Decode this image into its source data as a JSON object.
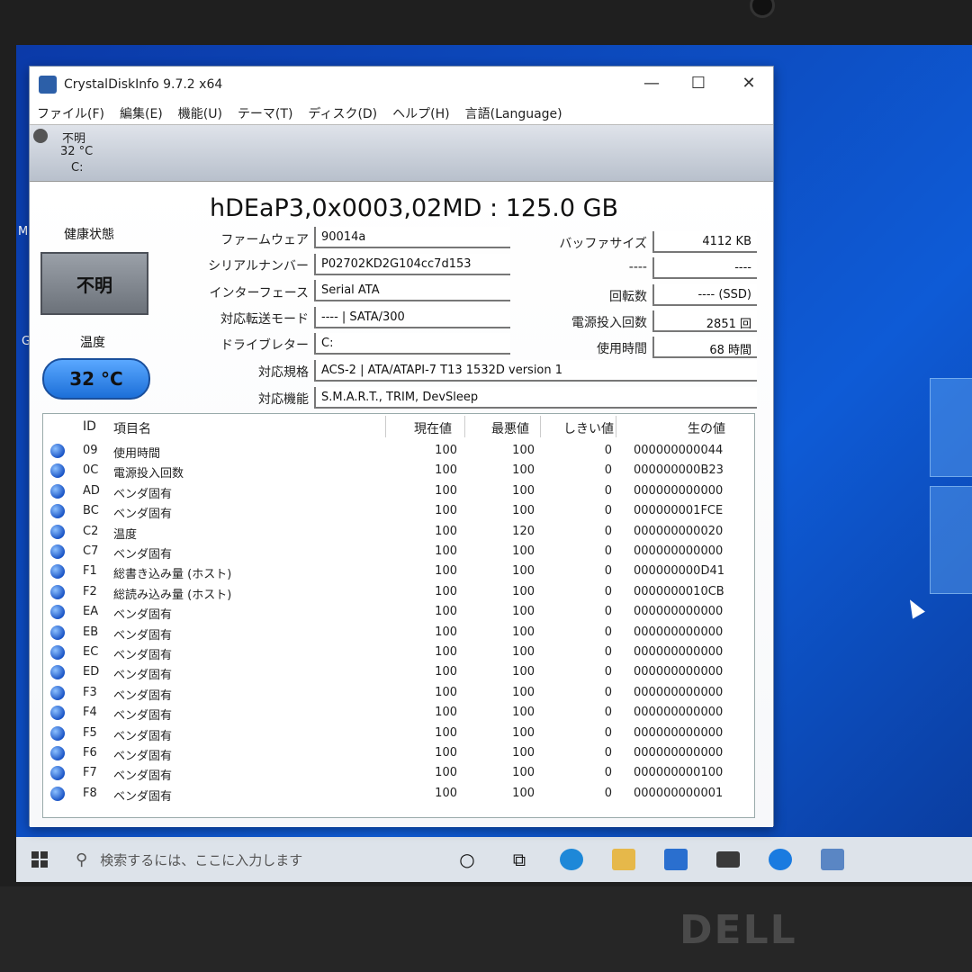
{
  "app": {
    "title": "CrystalDiskInfo 9.7.2 x64",
    "controls": {
      "minimize": "—",
      "maximize": "☐",
      "close": "✕"
    },
    "menu": [
      "ファイル(F)",
      "編集(E)",
      "機能(U)",
      "テーマ(T)",
      "ディスク(D)",
      "ヘルプ(H)",
      "言語(Language)"
    ]
  },
  "disk_tab": {
    "status": "不明",
    "temp": "32 °C",
    "letter": "C:"
  },
  "disk": {
    "model": "hDEaP3,0x0003,02MD : 125.0 GB",
    "health_label": "健康状態",
    "health_value": "不明",
    "temp_label": "温度",
    "temp_value": "32 °C",
    "firmware_label": "ファームウェア",
    "firmware": "90014a",
    "serial_label": "シリアルナンバー",
    "serial": "P02702KD2G104cc7d153",
    "interface_label": "インターフェース",
    "interface": "Serial ATA",
    "transfer_label": "対応転送モード",
    "transfer": "---- | SATA/300",
    "drive_label": "ドライブレター",
    "drive": "C:",
    "standard_label": "対応規格",
    "standard": "ACS-2 | ATA/ATAPI-7 T13 1532D version 1",
    "features_label": "対応機能",
    "features": "S.M.A.R.T., TRIM, DevSleep",
    "buffer_label": "バッファサイズ",
    "buffer": "4112 KB",
    "unknown_label": "----",
    "unknown": "----",
    "rotation_label": "回転数",
    "rotation": "---- (SSD)",
    "power_count_label": "電源投入回数",
    "power_count": "2851 回",
    "power_hours_label": "使用時間",
    "power_hours": "68 時間"
  },
  "smart": {
    "headers": {
      "id": "ID",
      "name": "項目名",
      "current": "現在値",
      "worst": "最悪値",
      "threshold": "しきい値",
      "raw": "生の値"
    },
    "rows": [
      {
        "id": "09",
        "name": "使用時間",
        "current": "100",
        "worst": "100",
        "threshold": "0",
        "raw": "000000000044"
      },
      {
        "id": "0C",
        "name": "電源投入回数",
        "current": "100",
        "worst": "100",
        "threshold": "0",
        "raw": "000000000B23"
      },
      {
        "id": "AD",
        "name": "ベンダ固有",
        "current": "100",
        "worst": "100",
        "threshold": "0",
        "raw": "000000000000"
      },
      {
        "id": "BC",
        "name": "ベンダ固有",
        "current": "100",
        "worst": "100",
        "threshold": "0",
        "raw": "000000001FCE"
      },
      {
        "id": "C2",
        "name": "温度",
        "current": "100",
        "worst": "120",
        "threshold": "0",
        "raw": "000000000020"
      },
      {
        "id": "C7",
        "name": "ベンダ固有",
        "current": "100",
        "worst": "100",
        "threshold": "0",
        "raw": "000000000000"
      },
      {
        "id": "F1",
        "name": "総書き込み量 (ホスト)",
        "current": "100",
        "worst": "100",
        "threshold": "0",
        "raw": "000000000D41"
      },
      {
        "id": "F2",
        "name": "総読み込み量 (ホスト)",
        "current": "100",
        "worst": "100",
        "threshold": "0",
        "raw": "0000000010CB"
      },
      {
        "id": "EA",
        "name": "ベンダ固有",
        "current": "100",
        "worst": "100",
        "threshold": "0",
        "raw": "000000000000"
      },
      {
        "id": "EB",
        "name": "ベンダ固有",
        "current": "100",
        "worst": "100",
        "threshold": "0",
        "raw": "000000000000"
      },
      {
        "id": "EC",
        "name": "ベンダ固有",
        "current": "100",
        "worst": "100",
        "threshold": "0",
        "raw": "000000000000"
      },
      {
        "id": "ED",
        "name": "ベンダ固有",
        "current": "100",
        "worst": "100",
        "threshold": "0",
        "raw": "000000000000"
      },
      {
        "id": "F3",
        "name": "ベンダ固有",
        "current": "100",
        "worst": "100",
        "threshold": "0",
        "raw": "000000000000"
      },
      {
        "id": "F4",
        "name": "ベンダ固有",
        "current": "100",
        "worst": "100",
        "threshold": "0",
        "raw": "000000000000"
      },
      {
        "id": "F5",
        "name": "ベンダ固有",
        "current": "100",
        "worst": "100",
        "threshold": "0",
        "raw": "000000000000"
      },
      {
        "id": "F6",
        "name": "ベンダ固有",
        "current": "100",
        "worst": "100",
        "threshold": "0",
        "raw": "000000000000"
      },
      {
        "id": "F7",
        "name": "ベンダ固有",
        "current": "100",
        "worst": "100",
        "threshold": "0",
        "raw": "000000000100"
      },
      {
        "id": "F8",
        "name": "ベンダ固有",
        "current": "100",
        "worst": "100",
        "threshold": "0",
        "raw": "000000000001"
      }
    ]
  },
  "taskbar": {
    "search_placeholder": "検索するには、ここに入力します",
    "icons": [
      "windows-start-icon",
      "search-icon",
      "cortana-icon",
      "task-view-icon",
      "edge-icon",
      "file-explorer-icon",
      "store-icon",
      "mail-icon",
      "app-icon-blue",
      "app-icon-disk"
    ]
  },
  "desktop": {
    "edge_text_1": "M",
    "edge_text_2": "G"
  },
  "bezel": {
    "brand": "DELL"
  },
  "colors": {
    "health_unknown": "#8a9098",
    "temp_good": "#3b8ef0",
    "status_dot": "#1b55c6"
  }
}
